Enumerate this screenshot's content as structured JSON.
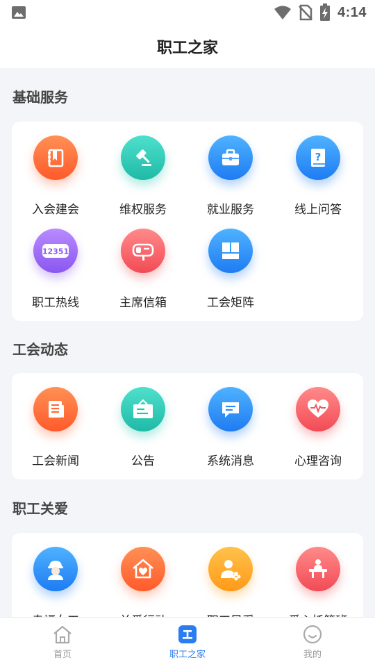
{
  "status_bar": {
    "time": "4:14"
  },
  "header": {
    "title": "职工之家"
  },
  "sections": [
    {
      "title": "基础服务",
      "items": [
        {
          "label": "入会建会",
          "icon": "membership-book-icon",
          "color": "#ff6a35"
        },
        {
          "label": "维权服务",
          "icon": "gavel-icon",
          "color": "#27c4b0"
        },
        {
          "label": "就业服务",
          "icon": "briefcase-icon",
          "color": "#2a8cf6"
        },
        {
          "label": "线上问答",
          "icon": "question-book-icon",
          "color": "#2a8cf6"
        },
        {
          "label": "职工热线",
          "icon": "hotline-12351-icon",
          "color": "#9465f4",
          "icon_text": "12351"
        },
        {
          "label": "主席信箱",
          "icon": "mailbox-icon",
          "color": "#f4565e"
        },
        {
          "label": "工会矩阵",
          "icon": "matrix-grid-icon",
          "color": "#2a8cf6"
        }
      ]
    },
    {
      "title": "工会动态",
      "items": [
        {
          "label": "工会新闻",
          "icon": "newspaper-icon",
          "color": "#ff6a35"
        },
        {
          "label": "公告",
          "icon": "notice-board-icon",
          "color": "#27c4b0"
        },
        {
          "label": "系统消息",
          "icon": "message-bubble-icon",
          "color": "#2a8cf6"
        },
        {
          "label": "心理咨询",
          "icon": "heart-pulse-icon",
          "color": "#f4565e"
        }
      ]
    },
    {
      "title": "职工关爱",
      "items": [
        {
          "label": "幸福女工",
          "icon": "female-worker-icon",
          "color": "#2a8cf6"
        },
        {
          "label": "关爱行动",
          "icon": "heart-house-icon",
          "color": "#ff6a35"
        },
        {
          "label": "职工风采",
          "icon": "worker-showcase-icon",
          "color": "#ff9f1f"
        },
        {
          "label": "爱心托管班",
          "icon": "childcare-desk-icon",
          "color": "#f4565e"
        }
      ]
    }
  ],
  "tabs": [
    {
      "label": "首页",
      "icon": "home-icon",
      "active": false
    },
    {
      "label": "职工之家",
      "icon": "workers-home-icon",
      "active": true
    },
    {
      "label": "我的",
      "icon": "profile-smile-icon",
      "active": false
    }
  ],
  "colors": {
    "accent": "#2a7cf0",
    "background": "#f3f5f9",
    "inactive_tab": "#999999"
  }
}
